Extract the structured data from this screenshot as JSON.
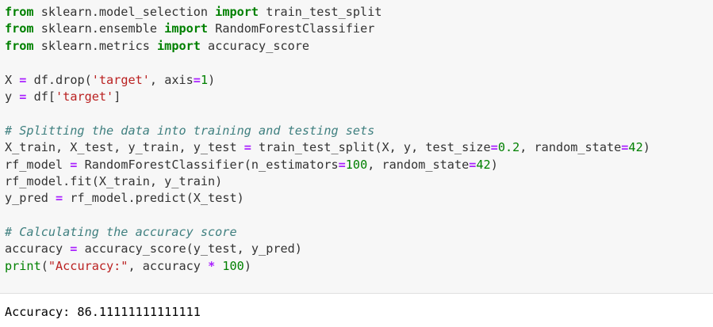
{
  "cell": {
    "code_lines": [
      [
        {
          "t": "kw",
          "v": "from"
        },
        {
          "t": "",
          "v": " sklearn.model_selection "
        },
        {
          "t": "kw",
          "v": "import"
        },
        {
          "t": "",
          "v": " train_test_split"
        }
      ],
      [
        {
          "t": "kw",
          "v": "from"
        },
        {
          "t": "",
          "v": " sklearn.ensemble "
        },
        {
          "t": "kw",
          "v": "import"
        },
        {
          "t": "",
          "v": " RandomForestClassifier"
        }
      ],
      [
        {
          "t": "kw",
          "v": "from"
        },
        {
          "t": "",
          "v": " sklearn.metrics "
        },
        {
          "t": "kw",
          "v": "import"
        },
        {
          "t": "",
          "v": " accuracy_score"
        }
      ],
      [],
      [
        {
          "t": "",
          "v": "X "
        },
        {
          "t": "op",
          "v": "="
        },
        {
          "t": "",
          "v": " df.drop("
        },
        {
          "t": "str",
          "v": "'target'"
        },
        {
          "t": "",
          "v": ", axis"
        },
        {
          "t": "op",
          "v": "="
        },
        {
          "t": "num",
          "v": "1"
        },
        {
          "t": "",
          "v": ")"
        }
      ],
      [
        {
          "t": "",
          "v": "y "
        },
        {
          "t": "op",
          "v": "="
        },
        {
          "t": "",
          "v": " df["
        },
        {
          "t": "str",
          "v": "'target'"
        },
        {
          "t": "",
          "v": "]"
        }
      ],
      [],
      [
        {
          "t": "cm",
          "v": "# Splitting the data into training and testing sets"
        }
      ],
      [
        {
          "t": "",
          "v": "X_train, X_test, y_train, y_test "
        },
        {
          "t": "op",
          "v": "="
        },
        {
          "t": "",
          "v": " train_test_split(X, y, test_size"
        },
        {
          "t": "op",
          "v": "="
        },
        {
          "t": "num",
          "v": "0.2"
        },
        {
          "t": "",
          "v": ", random_state"
        },
        {
          "t": "op",
          "v": "="
        },
        {
          "t": "num",
          "v": "42"
        },
        {
          "t": "",
          "v": ")"
        }
      ],
      [
        {
          "t": "",
          "v": "rf_model "
        },
        {
          "t": "op",
          "v": "="
        },
        {
          "t": "",
          "v": " RandomForestClassifier(n_estimators"
        },
        {
          "t": "op",
          "v": "="
        },
        {
          "t": "num",
          "v": "100"
        },
        {
          "t": "",
          "v": ", random_state"
        },
        {
          "t": "op",
          "v": "="
        },
        {
          "t": "num",
          "v": "42"
        },
        {
          "t": "",
          "v": ")"
        }
      ],
      [
        {
          "t": "",
          "v": "rf_model.fit(X_train, y_train)"
        }
      ],
      [
        {
          "t": "",
          "v": "y_pred "
        },
        {
          "t": "op",
          "v": "="
        },
        {
          "t": "",
          "v": " rf_model.predict(X_test)"
        }
      ],
      [],
      [
        {
          "t": "cm",
          "v": "# Calculating the accuracy score"
        }
      ],
      [
        {
          "t": "",
          "v": "accuracy "
        },
        {
          "t": "op",
          "v": "="
        },
        {
          "t": "",
          "v": " accuracy_score(y_test, y_pred)"
        }
      ],
      [
        {
          "t": "bi",
          "v": "print"
        },
        {
          "t": "",
          "v": "("
        },
        {
          "t": "str",
          "v": "\"Accuracy:\""
        },
        {
          "t": "",
          "v": ", accuracy "
        },
        {
          "t": "op",
          "v": "*"
        },
        {
          "t": "",
          "v": " "
        },
        {
          "t": "num",
          "v": "100"
        },
        {
          "t": "",
          "v": ")"
        }
      ]
    ],
    "output": "Accuracy: 86.11111111111111"
  },
  "colors": {
    "keyword": "#008000",
    "string": "#ba2121",
    "number": "#008000",
    "operator": "#aa22ff",
    "comment": "#408080",
    "input_background": "#f7f7f7"
  }
}
